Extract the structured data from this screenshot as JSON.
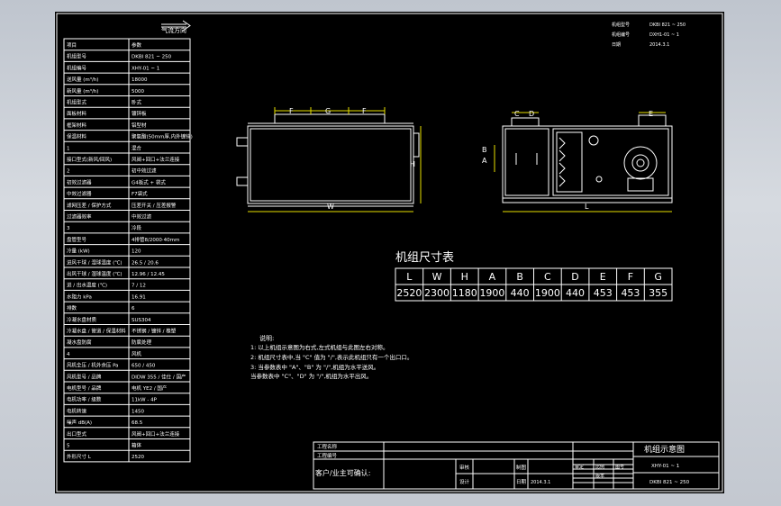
{
  "colors": {
    "background": "#000000",
    "line": "#ffffff",
    "dim": "#e8e000",
    "frame": "#c9ced6"
  },
  "header": {
    "airflow_label": "气流方向"
  },
  "top_right": {
    "rows": [
      [
        "机组型号",
        "DKBI 821 ~ 250"
      ],
      [
        "机组编号",
        "DXH1-01 ~ 1"
      ],
      [
        "日期",
        "2014.3.1"
      ]
    ]
  },
  "spec_table": {
    "rows": [
      [
        "项目",
        "参数"
      ],
      [
        "机组型号",
        "DKBI 821 ~ 250"
      ],
      [
        "机组编号",
        "XHY-01 ~ 1"
      ],
      [
        "送风量 (m³/h)",
        "18000"
      ],
      [
        "新风量 (m³/h)",
        "5000"
      ],
      [
        "机组型式",
        "卧式"
      ],
      [
        "面板材料",
        "镀锌板"
      ],
      [
        "框架材料",
        "铝型材"
      ],
      [
        "保温材料",
        "聚氨酯(50mm厚,内外镀锌)"
      ],
      [
        "1",
        "混合"
      ],
      [
        "接口型式(新风/回风)",
        "风阀+回口+法兰连接"
      ],
      [
        "2",
        "初中效过滤"
      ],
      [
        "初效过滤器",
        "G4板式 + 袋式"
      ],
      [
        "中效过滤器",
        "F7袋式"
      ],
      [
        "滤网压差 / 保护方式",
        "压差开关 / 压差报警"
      ],
      [
        "过滤器效率",
        "中效过滤"
      ],
      [
        "3",
        "冷段"
      ],
      [
        "盘管型号",
        "4排管8/2000·40mm"
      ],
      [
        "冷量 (kW)",
        "120"
      ],
      [
        "进风干球 / 湿球温度 (℃)",
        "26.5 / 20.6"
      ],
      [
        "出风干球 / 湿球温度 (℃)",
        "12.96 / 12.45"
      ],
      [
        "进 / 出水温度 (℃)",
        "7 / 12"
      ],
      [
        "水阻力 kPa",
        "16.91"
      ],
      [
        "排数",
        "6"
      ],
      [
        "冷凝水盘材质",
        "SUS304"
      ],
      [
        "冷凝水盘 / 管道 / 保温材料",
        "不锈钢 / 镀锌 / 橡塑"
      ],
      [
        "凝水盘防腐",
        "防腐处理"
      ],
      [
        "4",
        "风机"
      ],
      [
        "风机全压 / 机外余压 Pa",
        "650 / 450"
      ],
      [
        "风机型号 / 品牌",
        "DIDW 355 / 佳仕 / 国产"
      ],
      [
        "电机型号 / 品牌",
        "电机 YE2 / 国产"
      ],
      [
        "电机功率 / 级数",
        "11kW - 4P"
      ],
      [
        "电机转速",
        "1450"
      ],
      [
        "噪声 dB(A)",
        "68.5"
      ],
      [
        "出口型式",
        "风阀+回口+法兰连接"
      ],
      [
        "5",
        "箱体"
      ],
      [
        "外形尺寸 L",
        "2520"
      ]
    ]
  },
  "views": {
    "front": {
      "dims": [
        "F",
        "G",
        "F",
        "H",
        "W"
      ]
    },
    "side": {
      "dims": [
        "C",
        "D",
        "E",
        "A",
        "B",
        "L"
      ]
    }
  },
  "dimension_table": {
    "title": "机组尺寸表",
    "headers": [
      "L",
      "W",
      "H",
      "A",
      "B",
      "C",
      "D",
      "E",
      "F",
      "G"
    ],
    "values": [
      "2520",
      "2300",
      "1180",
      "1900",
      "440",
      "1900",
      "440",
      "453",
      "453",
      "355"
    ]
  },
  "notes": {
    "title": "说明:",
    "lines": [
      "1: 以上机组示意图为右式,左式机组与此图左右对称。",
      "2: 机组尺寸表中,当 \"C\" 值为 \"/\",表示此机组只有一个出口口。",
      "3: 当参数表中 \"A\"、\"B\" 为 \"/\",机组为水平送风。",
      "   当参数表中 \"C\"、\"D\" 为 \"/\",机组为水平出风。"
    ]
  },
  "title_block": {
    "project_label": "工程名称",
    "project_value": "",
    "drawing_no_label": "工程编号",
    "drawing_no_value": "",
    "customer_confirm": "客户/业主可确认:",
    "checked_label": "审核",
    "designed_label": "设计",
    "drawn_label": "制图",
    "approved_label": "审定",
    "date_label": "日期",
    "date_value": "2014.3.1",
    "scale_label": "比例",
    "sheet_label": "图号",
    "version_label": "版本",
    "title": "机组示意图",
    "model_line1": "XHY-01 ~ 1",
    "model_line2": "DKBI 821 ~ 250"
  }
}
